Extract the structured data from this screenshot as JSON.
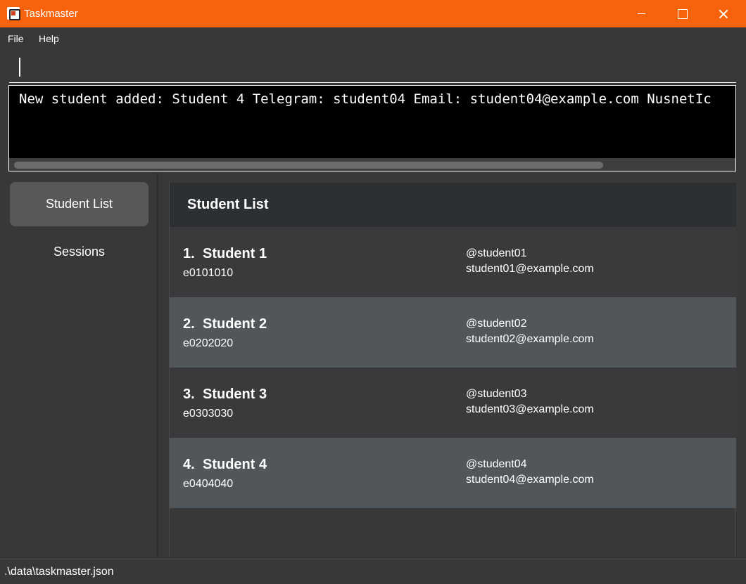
{
  "window": {
    "title": "Taskmaster",
    "accent_color": "#f7630c",
    "icons": {
      "app": "app-icon",
      "minimize": "minimize-icon",
      "maximize": "maximize-icon",
      "close": "close-icon"
    }
  },
  "menubar": {
    "file_label": "File",
    "help_label": "Help"
  },
  "command": {
    "value": ""
  },
  "result": {
    "text": "New student added: Student 4 Telegram: student04 Email: student04@example.com NusnetIc"
  },
  "sidebar": {
    "items": [
      {
        "label": "Student List",
        "active": true
      },
      {
        "label": "Sessions",
        "active": false
      }
    ]
  },
  "main": {
    "title": "Student List",
    "students": [
      {
        "index": "1.",
        "name": "Student 1",
        "nusnet": "e0101010",
        "telegram": "@student01",
        "email": "student01@example.com"
      },
      {
        "index": "2.",
        "name": "Student 2",
        "nusnet": "e0202020",
        "telegram": "@student02",
        "email": "student02@example.com"
      },
      {
        "index": "3.",
        "name": "Student 3",
        "nusnet": "e0303030",
        "telegram": "@student03",
        "email": "student03@example.com"
      },
      {
        "index": "4.",
        "name": "Student 4",
        "nusnet": "e0404040",
        "telegram": "@student04",
        "email": "student04@example.com"
      }
    ]
  },
  "status": {
    "path": ".\\data\\taskmaster.json"
  }
}
